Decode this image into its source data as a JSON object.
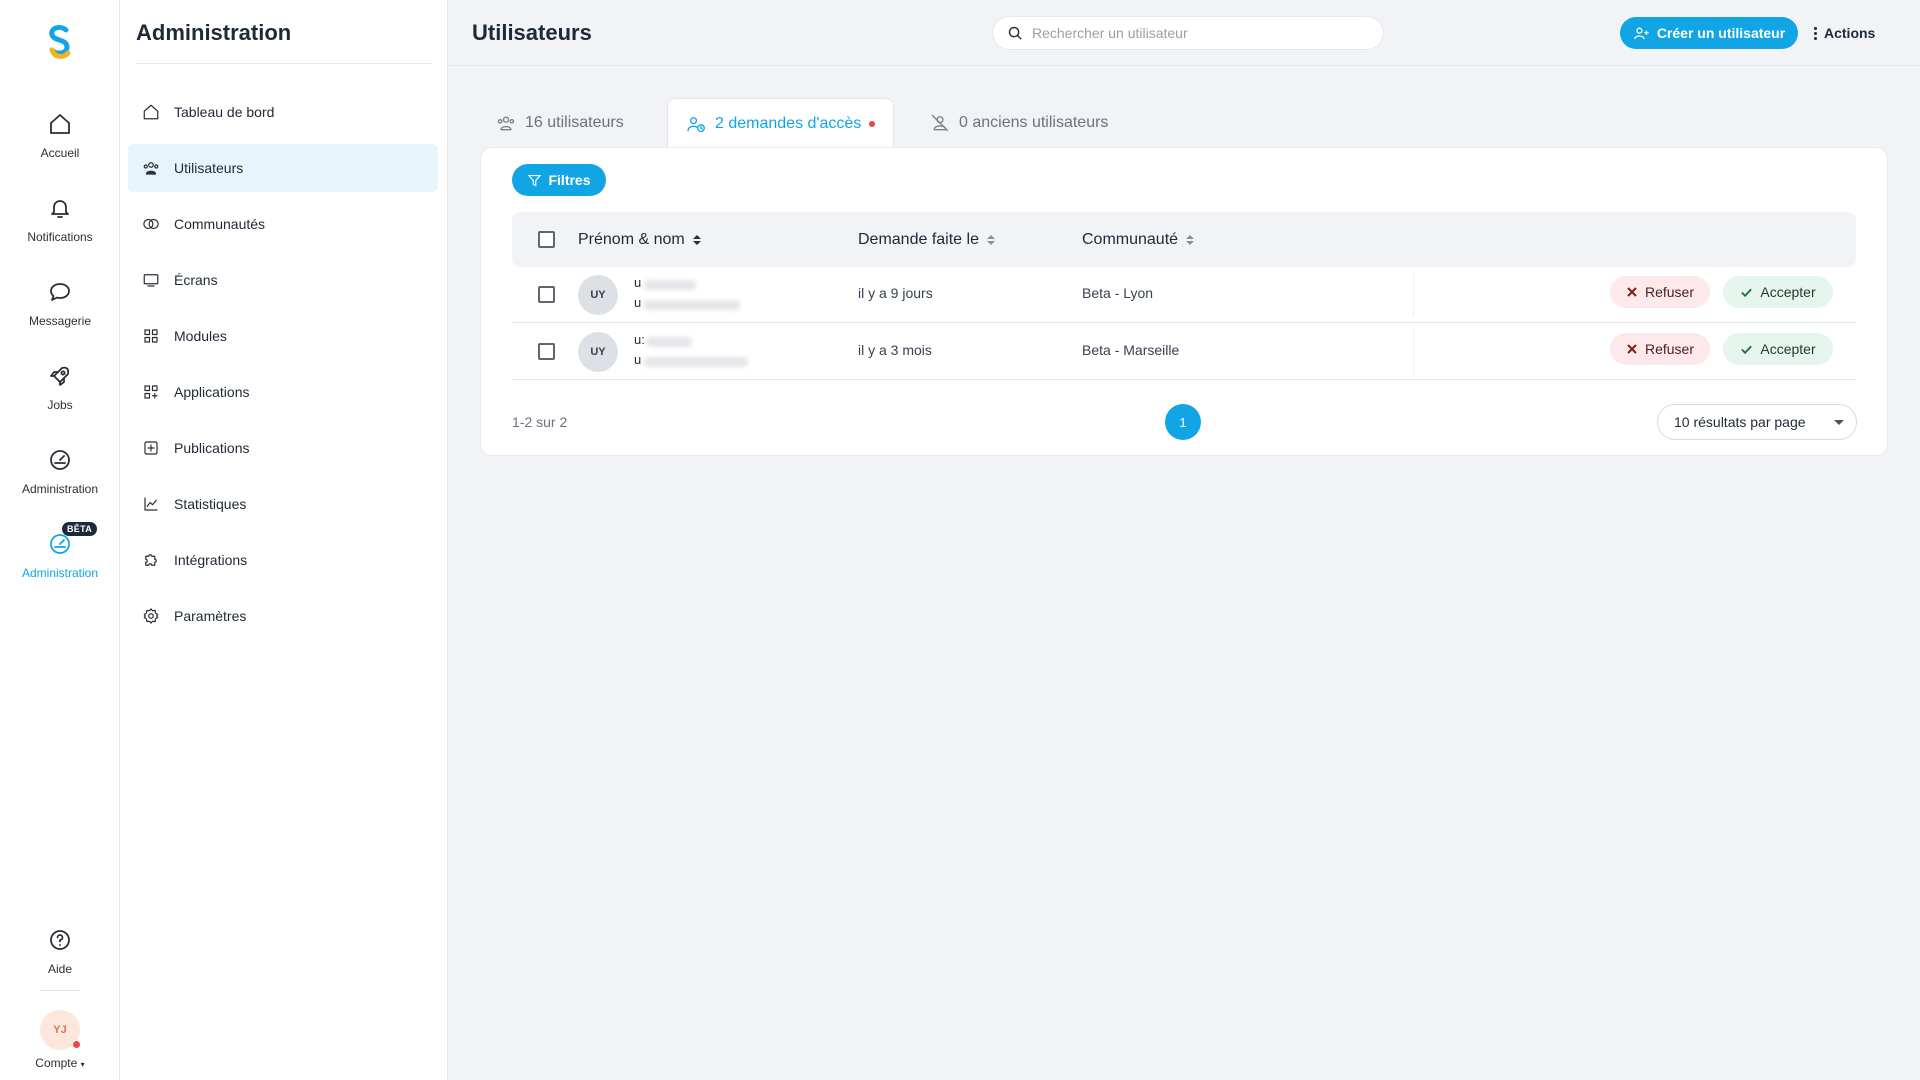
{
  "rail": {
    "items": [
      {
        "label": "Accueil",
        "icon": "home-icon"
      },
      {
        "label": "Notifications",
        "icon": "bell-icon"
      },
      {
        "label": "Messagerie",
        "icon": "chat-icon"
      },
      {
        "label": "Jobs",
        "icon": "rocket-icon"
      },
      {
        "label": "Administration",
        "icon": "gauge-icon"
      },
      {
        "label": "Administration",
        "icon": "gauge-icon",
        "badge": "BÊTA",
        "active": true
      }
    ],
    "help_label": "Aide",
    "account_initials": "YJ",
    "account_label": "Compte"
  },
  "sidebar": {
    "title": "Administration",
    "items": [
      {
        "label": "Tableau de bord",
        "icon": "home-icon"
      },
      {
        "label": "Utilisateurs",
        "icon": "users-icon",
        "active": true
      },
      {
        "label": "Communautés",
        "icon": "communities-icon"
      },
      {
        "label": "Écrans",
        "icon": "monitor-icon"
      },
      {
        "label": "Modules",
        "icon": "grid-icon"
      },
      {
        "label": "Applications",
        "icon": "apps-icon"
      },
      {
        "label": "Publications",
        "icon": "publication-icon"
      },
      {
        "label": "Statistiques",
        "icon": "chart-icon"
      },
      {
        "label": "Intégrations",
        "icon": "puzzle-icon"
      },
      {
        "label": "Paramètres",
        "icon": "gear-icon"
      }
    ]
  },
  "header": {
    "title": "Utilisateurs",
    "search_placeholder": "Rechercher un utilisateur",
    "create_label": "Créer un utilisateur",
    "actions_label": "Actions"
  },
  "tabs": [
    {
      "label": "16 utilisateurs",
      "icon": "users-icon"
    },
    {
      "label": "2 demandes d'accès",
      "icon": "user-clock-icon",
      "active": true,
      "dot": true
    },
    {
      "label": "0 anciens utilisateurs",
      "icon": "user-off-icon"
    }
  ],
  "filters_label": "Filtres",
  "table": {
    "columns": [
      "Prénom & nom",
      "Demande faite le",
      "Communauté"
    ],
    "rows": [
      {
        "initials": "UY",
        "name_visible": "u",
        "email_visible": "u",
        "requested": "il y a 9 jours",
        "community": "Beta - Lyon"
      },
      {
        "initials": "UY",
        "name_visible": "u:",
        "email_visible": "u",
        "requested": "il y a 3 mois",
        "community": "Beta - Marseille"
      }
    ],
    "refuse_label": "Refuser",
    "accept_label": "Accepter"
  },
  "pagination": {
    "range": "1-2 sur 2",
    "current_page": "1",
    "per_page": "10 résultats par page"
  },
  "colors": {
    "accent": "#12a5e6",
    "refuse_bg": "#fde9e9",
    "accept_bg": "#e6f6ee",
    "notification_dot": "#ef4444"
  }
}
